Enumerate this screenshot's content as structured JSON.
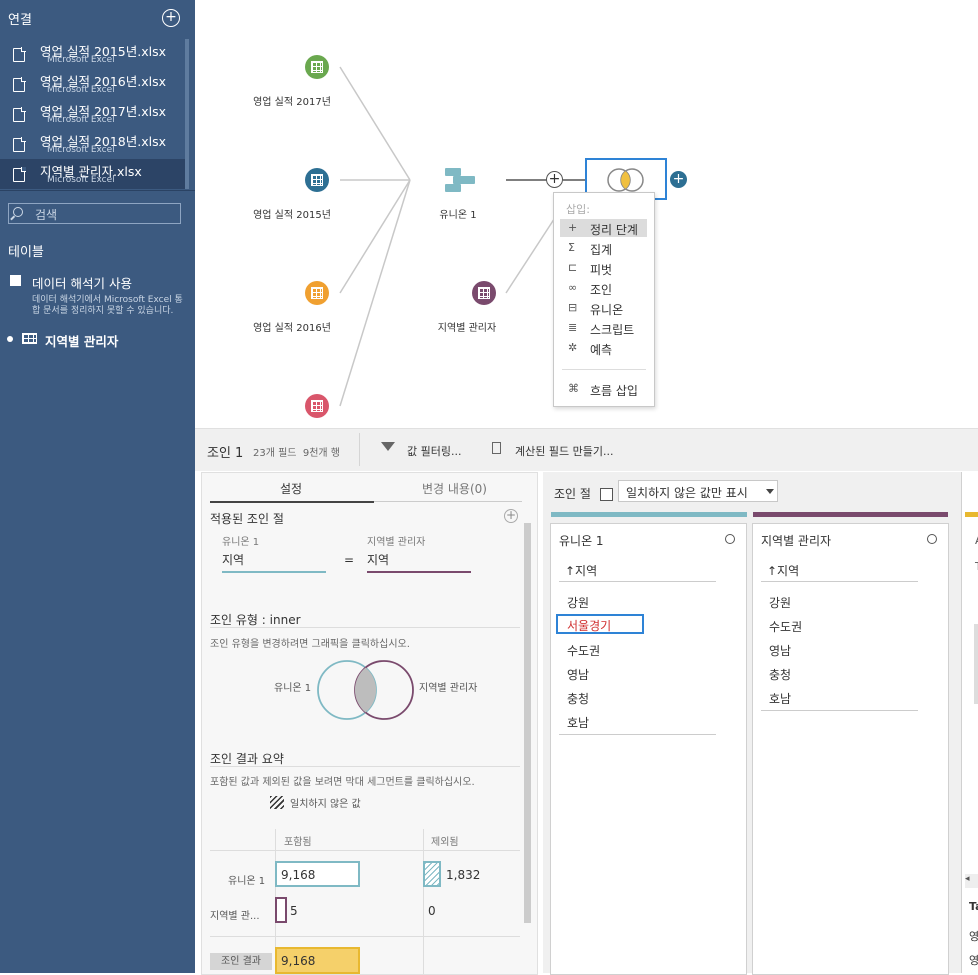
{
  "sidebar": {
    "title": "연결",
    "connections": [
      {
        "name": "영업 실적 2015년.xlsx",
        "type": "Microsoft Excel"
      },
      {
        "name": "영업 실적 2016년.xlsx",
        "type": "Microsoft Excel"
      },
      {
        "name": "영업 실적 2017년.xlsx",
        "type": "Microsoft Excel"
      },
      {
        "name": "영업 실적 2018년.xlsx",
        "type": "Microsoft Excel"
      },
      {
        "name": "지역별 관리자.xlsx",
        "type": "Microsoft Excel"
      }
    ],
    "search_placeholder": "검색",
    "tables_title": "테이블",
    "interpreter_label": "데이터 해석기 사용",
    "interpreter_desc1": "데이터 해석기에서 Microsoft Excel 통",
    "interpreter_desc2": "합 문서를 정리하지 못할 수 있습니다.",
    "table_item": "지역별 관리자"
  },
  "canvas": {
    "nodes": [
      {
        "label": "영업 실적 2017년",
        "color": "#6aa84f"
      },
      {
        "label": "영업 실적 2015년",
        "color": "#2d6f93"
      },
      {
        "label": "영업 실적 2016년",
        "color": "#f0a030"
      },
      {
        "label": "",
        "color": "#d9566b"
      }
    ],
    "union_label": "유니온 1",
    "manager_label": "지역별 관리자",
    "manager_color": "#7a4a6d"
  },
  "popup": {
    "title": "삽입:",
    "items": [
      "정리 단계",
      "집계",
      "피벗",
      "조인",
      "유니온",
      "스크립트",
      "예측"
    ],
    "flow_insert": "흐름 삽입"
  },
  "toolbar": {
    "title": "조인 1",
    "meta": "23개 필드  9천개 행",
    "filter_label": "값 필터링...",
    "calc_label": "계산된 필드 만들기..."
  },
  "settings": {
    "tab_settings": "설정",
    "tab_changes": "변경 내용(0)",
    "applied_title": "적용된 조인 절",
    "left_source": "유니온 1",
    "left_field": "지역",
    "equals": "=",
    "right_source": "지역별 관리자",
    "right_field": "지역",
    "join_type_title": "조인 유형 : inner",
    "join_type_hint": "조인 유형을 변경하려면 그래픽을 클릭하십시오.",
    "venn_left": "유니온 1",
    "venn_right": "지역별 관리자",
    "summary_title": "조인 결과 요약",
    "summary_hint": "포함된 값과 제외된 값을 보려면 막대 세그먼트를 클릭하십시오.",
    "unmatched_label": "일치하지 않은 값",
    "col_included": "포함됨",
    "col_excluded": "제외됨",
    "row1_label": "유니온 1",
    "row1_included": "9,168",
    "row1_excluded": "1,832",
    "row2_label": "지역별 관...",
    "row2_included": "5",
    "row2_excluded": "0",
    "row3_label": "조인 결과",
    "row3_included": "9,168"
  },
  "join_clause": {
    "title": "조인 절",
    "unmatched_only": "일치하지 않은 값만 표시",
    "left_table": "유니온 1",
    "left_field": "↑지역",
    "left_values": [
      "강원",
      "서울경기",
      "수도권",
      "영남",
      "충청",
      "호남"
    ],
    "right_table": "지역별 관리자",
    "right_field": "↑지역",
    "right_values": [
      "강원",
      "수도권",
      "영남",
      "충청",
      "호남"
    ]
  },
  "right_strip": {
    "letter": "A",
    "letter2": "T",
    "bottom1": "Ta",
    "bottom2": "영",
    "bottom3": "영"
  },
  "colors": {
    "sidebar_bg": "#3c5a80",
    "union_color": "#7fb9c4",
    "manager_color": "#7a4a6d",
    "join_highlight": "#f5d06a",
    "accent_blue": "#2e83d6"
  }
}
